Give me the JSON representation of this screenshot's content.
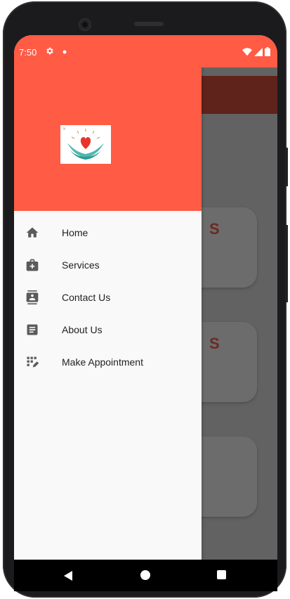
{
  "status_bar": {
    "time": "7:50",
    "icons": [
      "gear-icon",
      "notification-dot-icon",
      "wifi-icon",
      "cell-signal-icon",
      "battery-icon"
    ]
  },
  "drawer": {
    "items": [
      {
        "label": "Home",
        "icon": "home-icon"
      },
      {
        "label": "Services",
        "icon": "medical-kit-icon"
      },
      {
        "label": "Contact Us",
        "icon": "contact-card-icon"
      },
      {
        "label": "About Us",
        "icon": "document-icon"
      },
      {
        "label": "Make Appointment",
        "icon": "grid-pen-icon"
      }
    ]
  },
  "background_cards": [
    {
      "glyph": "S"
    },
    {
      "glyph": "S"
    },
    {
      "glyph": ""
    }
  ],
  "colors": {
    "accent": "#ff5b45",
    "app_bar_dimmed": "#5f231c",
    "scrim": "#626262",
    "drawer_bg": "#f9f9f9",
    "icon": "#5a5a5a"
  }
}
